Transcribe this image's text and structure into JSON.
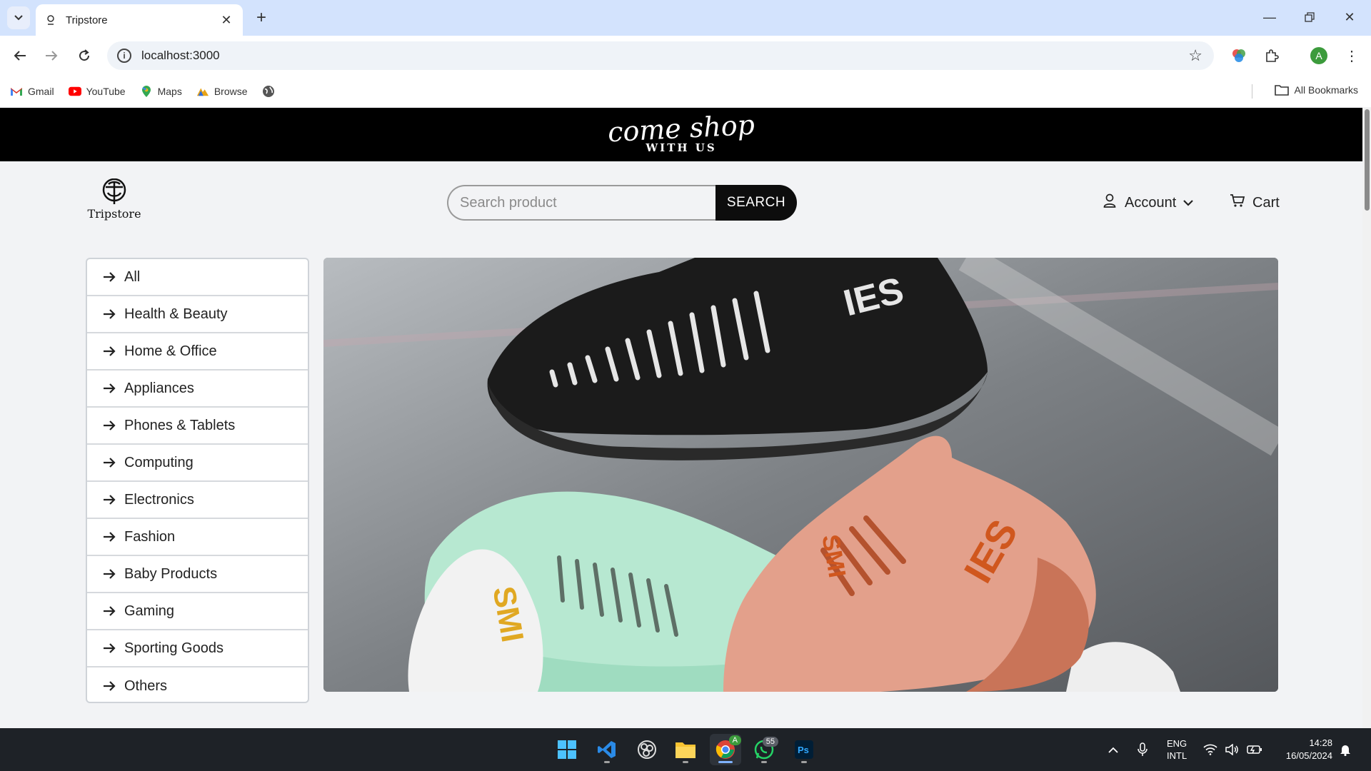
{
  "browser": {
    "tab_title": "Tripstore",
    "url": "localhost:3000",
    "profile_initial": "A",
    "bookmarks": [
      {
        "label": "Gmail",
        "icon": "gmail-icon"
      },
      {
        "label": "YouTube",
        "icon": "youtube-icon"
      },
      {
        "label": "Maps",
        "icon": "maps-icon"
      },
      {
        "label": "Browse",
        "icon": "browse-icon"
      }
    ],
    "all_bookmarks_label": "All Bookmarks"
  },
  "promo": {
    "script_text": "come shop",
    "sub_text": "WITH US"
  },
  "header": {
    "logo_text": "Tripstore",
    "search_placeholder": "Search product",
    "search_button": "SEARCH",
    "account_label": "Account",
    "cart_label": "Cart"
  },
  "categories": [
    "All",
    "Health & Beauty",
    "Home & Office",
    "Appliances",
    "Phones & Tablets",
    "Computing",
    "Electronics",
    "Fashion",
    "Baby Products",
    "Gaming",
    "Sporting Goods",
    "Others"
  ],
  "hero": {
    "sneaker_text_1": "IES",
    "sneaker_text_2": "IES",
    "sneaker_text_3": "SMI",
    "sneaker_text_4": "SMI"
  },
  "taskbar": {
    "whatsapp_badge": "55",
    "language_line1": "ENG",
    "language_line2": "INTL",
    "time": "14:28",
    "date": "16/05/2024"
  },
  "colors": {
    "promo_bg": "#000000",
    "page_bg": "#f2f3f5",
    "search_button_bg": "#0d0d0d",
    "tabbar_bg": "#d3e3fd",
    "taskbar_bg": "#1e2227"
  }
}
